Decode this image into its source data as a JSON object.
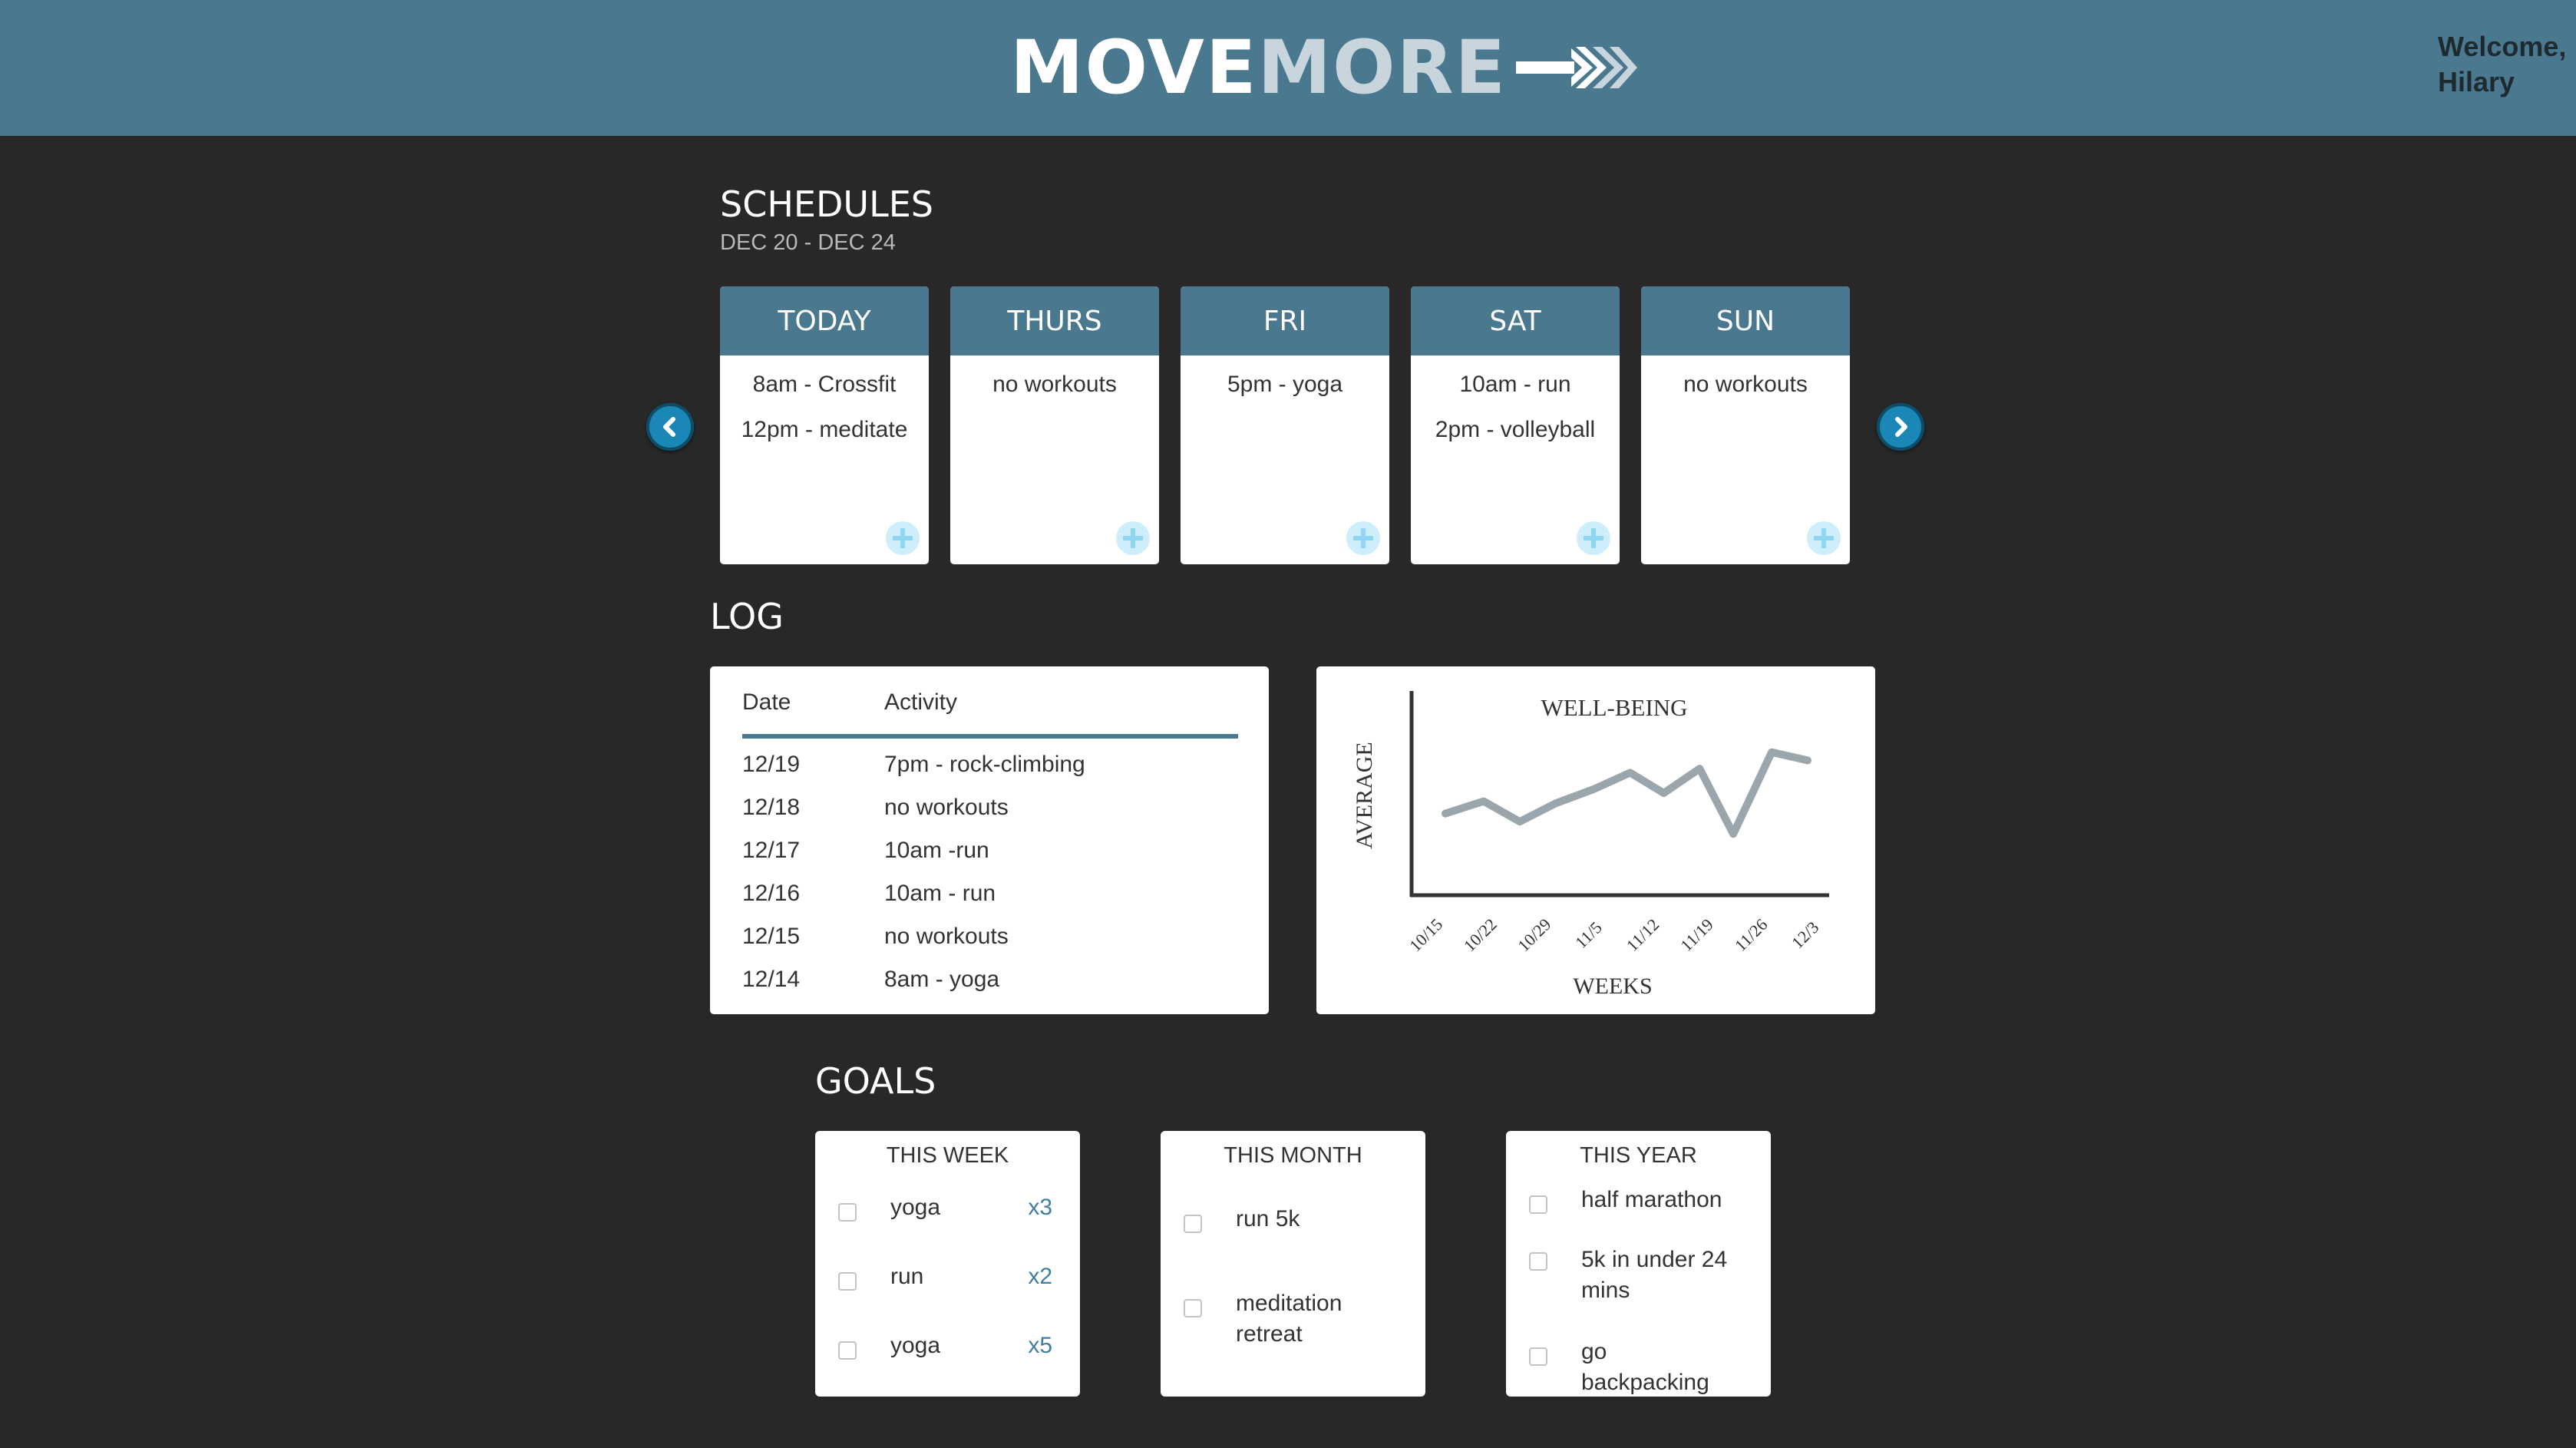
{
  "header": {
    "logo_part1": "MOVE",
    "logo_part2": "MORE",
    "welcome_line1": "Welcome,",
    "welcome_line2": "Hilary",
    "colors": {
      "bar": "#4a788f",
      "logo_light": "#c9d5dc"
    }
  },
  "schedules": {
    "title": "SCHEDULES",
    "date_range": "DEC 20 - DEC 24",
    "days": [
      {
        "label": "TODAY",
        "entries": [
          "8am - Crossfit",
          "12pm - meditate"
        ]
      },
      {
        "label": "THURS",
        "entries": [
          "no workouts"
        ]
      },
      {
        "label": "FRI",
        "entries": [
          "5pm - yoga"
        ]
      },
      {
        "label": "SAT",
        "entries": [
          "10am - run",
          "2pm - volleyball"
        ]
      },
      {
        "label": "SUN",
        "entries": [
          "no workouts"
        ]
      }
    ],
    "icons": {
      "prev": "chevron-left-icon",
      "next": "chevron-right-icon",
      "add": "plus-icon"
    }
  },
  "log": {
    "title": "LOG",
    "columns": [
      "Date",
      "Activity"
    ],
    "rows": [
      {
        "date": "12/19",
        "activity": "7pm - rock-climbing"
      },
      {
        "date": "12/18",
        "activity": "no workouts"
      },
      {
        "date": "12/17",
        "activity": "10am -run"
      },
      {
        "date": "12/16",
        "activity": "10am - run"
      },
      {
        "date": "12/15",
        "activity": "no workouts"
      },
      {
        "date": "12/14",
        "activity": "8am - yoga"
      }
    ]
  },
  "chart_data": {
    "type": "line",
    "title": "WELL-BEING",
    "xlabel": "WEEKS",
    "ylabel": "AVERAGE",
    "x_ticks": [
      "10/15",
      "10/22",
      "10/29",
      "11/5",
      "11/12",
      "11/19",
      "11/26",
      "12/3"
    ],
    "x": [
      0,
      0.5,
      1,
      1.5,
      2,
      2.5,
      3,
      3.5,
      4,
      4.5,
      5,
      5.5,
      6,
      6.5,
      7
    ],
    "values": [
      4.0,
      4.6,
      3.6,
      4.5,
      5.2,
      6.0,
      5.0,
      6.2,
      3.0,
      7.0,
      6.6
    ],
    "x_points": [
      0,
      0.8,
      1.55,
      2.3,
      3.1,
      3.85,
      4.55,
      5.3,
      6.0,
      6.8,
      7.55
    ],
    "ylim": [
      0,
      10
    ],
    "grid": false,
    "line_color": "#9aa5ac"
  },
  "goals": {
    "title": "GOALS",
    "cards": [
      {
        "title": "THIS WEEK",
        "items": [
          {
            "label": "yoga",
            "count": "x3"
          },
          {
            "label": "run",
            "count": "x2"
          },
          {
            "label": "yoga",
            "count": "x5"
          }
        ]
      },
      {
        "title": "THIS MONTH",
        "items": [
          {
            "label": "run 5k"
          },
          {
            "label": "meditation retreat"
          }
        ]
      },
      {
        "title": "THIS YEAR",
        "items": [
          {
            "label": "half marathon"
          },
          {
            "label": "5k in under 24 mins"
          },
          {
            "label": "go backpacking"
          }
        ]
      }
    ]
  }
}
